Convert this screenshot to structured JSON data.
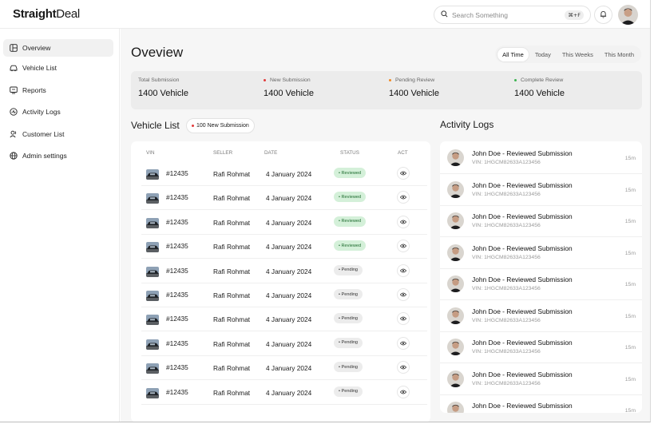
{
  "app": {
    "logo_bold": "Straight",
    "logo_light": "Deal"
  },
  "header": {
    "search_placeholder": "Search Something",
    "shortcut": "⌘+F"
  },
  "sidebar": {
    "items": [
      {
        "label": "Overview",
        "icon": "layout-icon",
        "active": true
      },
      {
        "label": "Vehicle List",
        "icon": "car-icon",
        "active": false
      },
      {
        "label": "Reports",
        "icon": "report-icon",
        "active": false
      },
      {
        "label": "Activity Logs",
        "icon": "activity-icon",
        "active": false
      },
      {
        "label": "Customer List",
        "icon": "users-icon",
        "active": false
      },
      {
        "label": "Admin settings",
        "icon": "globe-icon",
        "active": false
      }
    ]
  },
  "main": {
    "title": "Oveview",
    "filters": [
      "All Time",
      "Today",
      "This Weeks",
      "This Month"
    ],
    "stats": [
      {
        "label": "Total Submission",
        "value": "1400 Vehicle",
        "dot_color": ""
      },
      {
        "label": "New Submission",
        "value": "1400 Vehicle",
        "dot_color": "#e23b3b"
      },
      {
        "label": "Pending Review",
        "value": "1400 Vehicle",
        "dot_color": "#f08a24"
      },
      {
        "label": "Complete Review",
        "value": "1400 Vehicle",
        "dot_color": "#3cb451"
      }
    ]
  },
  "vehicle_list": {
    "title": "Vehicle List",
    "badge": "100 New Submission",
    "columns": [
      "VIN",
      "SELLER",
      "DATE",
      "STATUS",
      "ACT"
    ],
    "rows": [
      {
        "vin": "#12435",
        "seller": "Rafi Rohmat",
        "date": "4 January 2024",
        "status": "Reviewed"
      },
      {
        "vin": "#12435",
        "seller": "Rafi Rohmat",
        "date": "4 January 2024",
        "status": "Reviewed"
      },
      {
        "vin": "#12435",
        "seller": "Rafi Rohmat",
        "date": "4 January 2024",
        "status": "Reviewed"
      },
      {
        "vin": "#12435",
        "seller": "Rafi Rohmat",
        "date": "4 January 2024",
        "status": "Reviewed"
      },
      {
        "vin": "#12435",
        "seller": "Rafi Rohmat",
        "date": "4 January 2024",
        "status": "Pending"
      },
      {
        "vin": "#12435",
        "seller": "Rafi Rohmat",
        "date": "4 January 2024",
        "status": "Pending"
      },
      {
        "vin": "#12435",
        "seller": "Rafi Rohmat",
        "date": "4 January 2024",
        "status": "Pending"
      },
      {
        "vin": "#12435",
        "seller": "Rafi Rohmat",
        "date": "4 January 2024",
        "status": "Pending"
      },
      {
        "vin": "#12435",
        "seller": "Rafi Rohmat",
        "date": "4 January 2024",
        "status": "Pending"
      },
      {
        "vin": "#12435",
        "seller": "Rafi Rohmat",
        "date": "4 January 2024",
        "status": "Pending"
      }
    ]
  },
  "activity_logs": {
    "title": "Activity Logs",
    "items": [
      {
        "title": "John Doe - Reviewed Submission",
        "vin": "VIN: 1HGCM82633A123456",
        "time": "15m"
      },
      {
        "title": "John Doe - Reviewed Submission",
        "vin": "VIN: 1HGCM82633A123456",
        "time": "15m"
      },
      {
        "title": "John Doe - Reviewed Submission",
        "vin": "VIN: 1HGCM82633A123456",
        "time": "15m"
      },
      {
        "title": "John Doe - Reviewed Submission",
        "vin": "VIN: 1HGCM82633A123456",
        "time": "15m"
      },
      {
        "title": "John Doe - Reviewed Submission",
        "vin": "VIN: 1HGCM82633A123456",
        "time": "15m"
      },
      {
        "title": "John Doe - Reviewed Submission",
        "vin": "VIN: 1HGCM82633A123456",
        "time": "15m"
      },
      {
        "title": "John Doe - Reviewed Submission",
        "vin": "VIN: 1HGCM82633A123456",
        "time": "15m"
      },
      {
        "title": "John Doe - Reviewed Submission",
        "vin": "VIN: 1HGCM82633A123456",
        "time": "15m"
      },
      {
        "title": "John Doe - Reviewed Submission",
        "vin": "",
        "time": "15m"
      }
    ]
  },
  "colors": {
    "reviewed_bg": "#d4f0d9",
    "reviewed_text": "#1d6b2e",
    "pending_bg": "#ececec"
  }
}
